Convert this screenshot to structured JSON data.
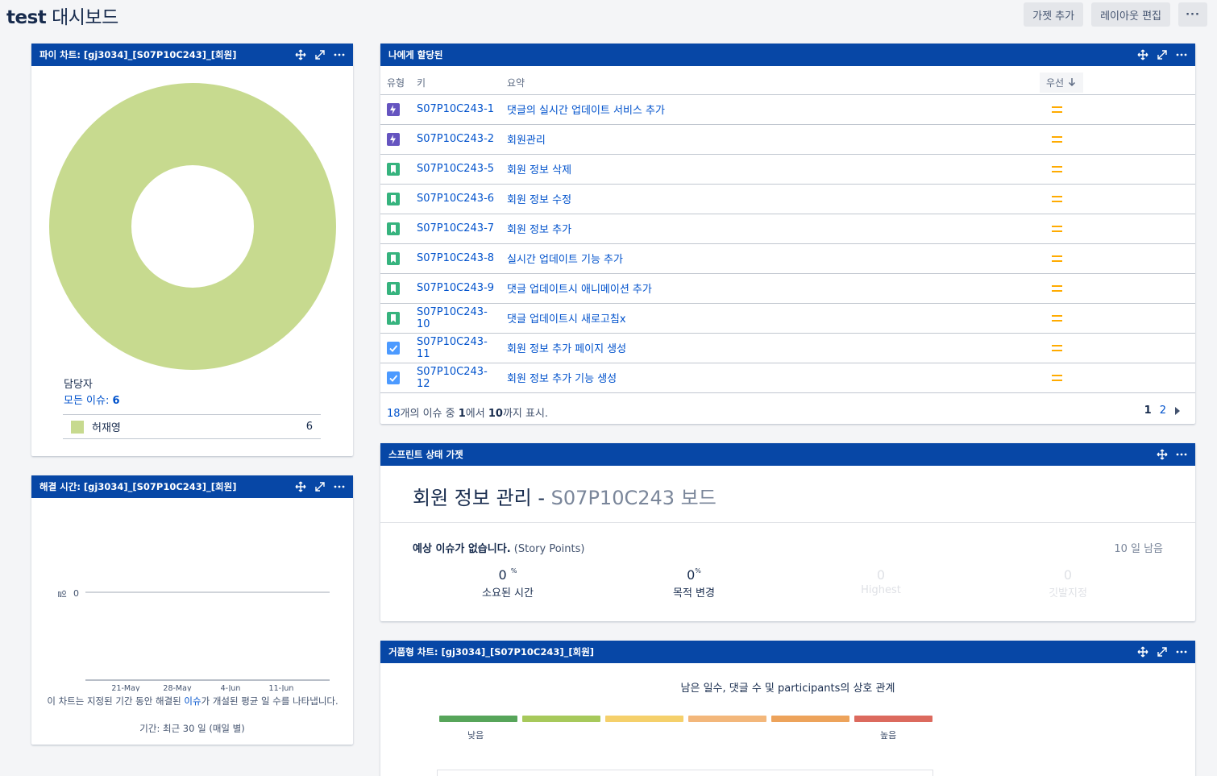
{
  "header": {
    "title_prefix": "test",
    "title_suffix": "대시보드",
    "add_gadget": "가젯 추가",
    "edit_layout": "레이아웃 편집",
    "more": "···"
  },
  "pie_gadget": {
    "title": "파이 차트: [gj3034]_[S07P10C243]_[회원]",
    "legend_title": "담당자",
    "all_issues_label": "모든 이슈:",
    "all_issues_count": "6",
    "rows": [
      {
        "name": "허재영",
        "count": "6",
        "color": "#c7da8f"
      }
    ]
  },
  "chart_data": [
    {
      "type": "pie",
      "title": "",
      "categories": [
        "허재영"
      ],
      "values": [
        6
      ],
      "colors": [
        "#c7da8f"
      ],
      "donut": true
    },
    {
      "type": "line",
      "title": "",
      "ylabel": "일",
      "y_ticks": [
        "0"
      ],
      "x_ticks": [
        "21-May",
        "28-May",
        "4-Jun",
        "11-Jun"
      ],
      "series": []
    }
  ],
  "resolution_gadget": {
    "title": "해결 시간: [gj3034]_[S07P10C243]_[회원]",
    "note_part1": "이 차트는 지정된 기간 동안 해결된 ",
    "note_link": "이슈",
    "note_part2": "가 개설된 평균 일 수를 나타냅니다.",
    "period": "기간: 최근 30 일 (매일 별)"
  },
  "assigned_gadget": {
    "title": "나에게 할당된",
    "columns": {
      "type": "유형",
      "key": "키",
      "summary": "요약",
      "priority": "우선"
    },
    "issues": [
      {
        "type": "epic",
        "key": "S07P10C243-1",
        "summary": "댓글의 실시간 업데이트 서비스 추가",
        "priority": "medium"
      },
      {
        "type": "epic",
        "key": "S07P10C243-2",
        "summary": "회원관리",
        "priority": "medium"
      },
      {
        "type": "story",
        "key": "S07P10C243-5",
        "summary": "회원 정보 삭제",
        "priority": "medium"
      },
      {
        "type": "story",
        "key": "S07P10C243-6",
        "summary": "회원 정보 수정",
        "priority": "medium"
      },
      {
        "type": "story",
        "key": "S07P10C243-7",
        "summary": "회원 정보 추가",
        "priority": "medium"
      },
      {
        "type": "story",
        "key": "S07P10C243-8",
        "summary": "실시간 업데이트 기능 추가",
        "priority": "medium"
      },
      {
        "type": "story",
        "key": "S07P10C243-9",
        "summary": "댓글 업데이트시 애니메이션 추가",
        "priority": "medium"
      },
      {
        "type": "story",
        "key": "S07P10C243-10",
        "summary": "댓글 업데이트시 새로고침x",
        "priority": "medium"
      },
      {
        "type": "task",
        "key": "S07P10C243-11",
        "summary": "회원 정보 추가 페이지 생성",
        "priority": "medium"
      },
      {
        "type": "task",
        "key": "S07P10C243-12",
        "summary": "회원 정보 추가 기능 생성",
        "priority": "medium"
      }
    ],
    "pager_total": "18",
    "pager_t1": "개의 이슈 중 ",
    "pager_from": "1",
    "pager_t2": "에서 ",
    "pager_to": "10",
    "pager_t3": "까지 표시.",
    "page_current": "1",
    "page_next": "2"
  },
  "sprint_gadget": {
    "title": "스프린트 상태 가젯",
    "sprint_name": "회원 정보 관리",
    "dash": " - ",
    "board_name": "S07P10C243 보드",
    "estimate_bold": "예상 이슈가 없습니다.",
    "estimate_unit": "(Story Points)",
    "remaining": "10 일 남음",
    "stats": [
      {
        "num": "0",
        "pct": "%",
        "label": "소요된 시간",
        "faded": false
      },
      {
        "num": "0",
        "pct": "%",
        "label": "목적 변경",
        "faded": false
      },
      {
        "num": "0",
        "pct": "",
        "label": "Highest",
        "faded": true
      },
      {
        "num": "0",
        "pct": "",
        "label": "깃발지정",
        "faded": true
      }
    ]
  },
  "bubble_gadget": {
    "title": "거품형 차트: [gj3034]_[S07P10C243]_[회원]",
    "chart_title": "남은 일수, 댓글 수 및 participants의 상호 관계",
    "scale_colors": [
      "#57a55a",
      "#a7c95b",
      "#f5d06b",
      "#f3b77b",
      "#eda35b",
      "#dc6a5e"
    ],
    "low_label": "낮음",
    "high_label": "높음"
  },
  "colors": {
    "gadget_header": "#0747a6",
    "link": "#0052cc",
    "priority_medium": "#ffab00",
    "epic": "#6554c0",
    "story": "#36b37e",
    "task": "#4c9aff"
  }
}
